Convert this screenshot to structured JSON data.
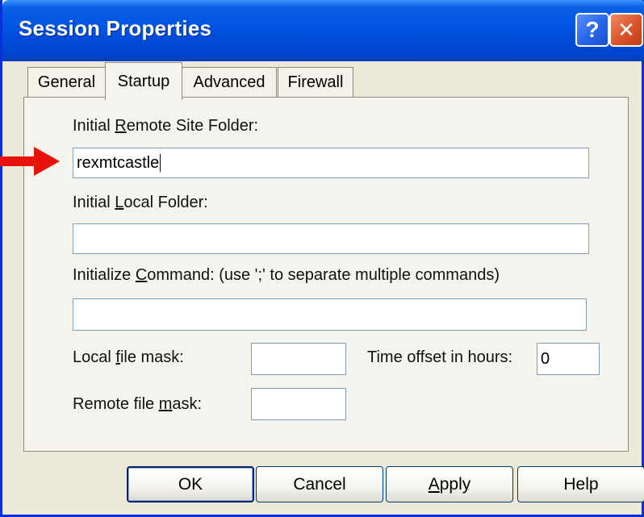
{
  "window": {
    "title": "Session Properties",
    "help_glyph": "?",
    "close_glyph": "✕"
  },
  "tabs": [
    {
      "label": "General",
      "active": false
    },
    {
      "label": "Startup",
      "active": true
    },
    {
      "label": "Advanced",
      "active": false
    },
    {
      "label": "Firewall",
      "active": false
    }
  ],
  "startup": {
    "remote_folder": {
      "label_pre": "Initial ",
      "mnemonic": "R",
      "label_post": "emote Site Folder:",
      "value": "rexmtcastle"
    },
    "local_folder": {
      "label_pre": "Initial ",
      "mnemonic": "L",
      "label_post": "ocal Folder:",
      "value": ""
    },
    "init_command": {
      "label_pre": "Initialize ",
      "mnemonic": "C",
      "label_post": "ommand: (use ';' to separate multiple commands)",
      "value": ""
    },
    "local_mask": {
      "label_pre": "Local ",
      "mnemonic": "f",
      "label_post": "ile mask:",
      "value": ""
    },
    "remote_mask": {
      "label_pre": "Remote file ",
      "mnemonic": "m",
      "label_post": "ask:",
      "value": ""
    },
    "time_offset": {
      "label": "Time offset in hours:",
      "value": "0"
    }
  },
  "buttons": {
    "ok": "OK",
    "cancel": "Cancel",
    "apply_mnemonic": "A",
    "apply_rest": "pply",
    "help": "Help"
  },
  "colors": {
    "title_bar": "#0054e3",
    "close_button": "#d9532c",
    "annotation_arrow": "#e8120c"
  },
  "icons": [
    "help-icon",
    "close-icon",
    "annotation-arrow-icon"
  ]
}
